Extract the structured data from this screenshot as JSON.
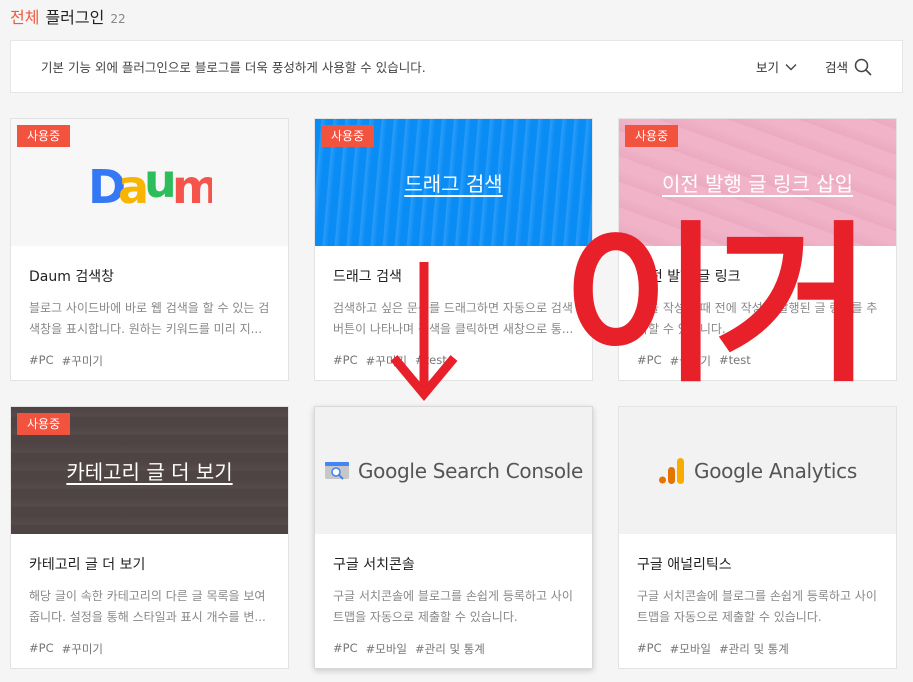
{
  "header": {
    "title_accent": "전체",
    "title_main": "플러그인",
    "count": "22"
  },
  "info_bar": {
    "description": "기본 기능 외에 플러그인으로 블로그를 더욱 풍성하게 사용할 수 있습니다.",
    "view_label": "보기",
    "search_label": "검색"
  },
  "cards": [
    {
      "badge": "사용중",
      "thumb_title": "",
      "name": "Daum 검색창",
      "desc": "블로그 사이드바에 바로 웹 검색을 할 수 있는 검색창을 표시합니다. 원하는 키워드를 미리 지...",
      "tags": [
        "#PC",
        "#꾸미기"
      ]
    },
    {
      "badge": "사용중",
      "thumb_title": "드래그 검색",
      "name": "드래그 검색",
      "desc": "검색하고 싶은 문구를 드래그하면 자동으로 검색 버튼이 나타나며 검색을 클릭하면 새창으로 통...",
      "tags": [
        "#PC",
        "#꾸미기",
        "#test"
      ]
    },
    {
      "badge": "사용중",
      "thumb_title": "이전 발행 글 링크 삽입",
      "name": "이전 발행 글 링크",
      "desc": "글을 작성할 때 전에 작성한 발행된 글 링크를 추가할 수 있습니다.",
      "tags": [
        "#PC",
        "#글쓰기",
        "#test"
      ]
    },
    {
      "badge": "사용중",
      "thumb_title": "카테고리 글 더 보기",
      "name": "카테고리 글 더 보기",
      "desc": "해당 글이 속한 카테고리의 다른 글 목록을 보여줍니다. 설정을 통해 스타일과 표시 개수를 변...",
      "tags": [
        "#PC",
        "#꾸미기"
      ]
    },
    {
      "badge": "",
      "thumb_title": "",
      "logo_text": "Google Search Console",
      "name": "구글 서치콘솔",
      "desc": "구글 서치콘솔에 블로그를 손쉽게 등록하고 사이트맵을 자동으로 제출할 수 있습니다.",
      "tags": [
        "#PC",
        "#모바일",
        "#관리 및 통계"
      ]
    },
    {
      "badge": "",
      "thumb_title": "",
      "logo_text": "Google Analytics",
      "name": "구글 애널리틱스",
      "desc": "구글 서치콘솔에 블로그를 손쉽게 등록하고 사이트맵을 자동으로 제출할 수 있습니다.",
      "tags": [
        "#PC",
        "#모바일",
        "#관리 및 통계"
      ]
    }
  ],
  "annotation": {
    "text": "↓ 이거",
    "color": "#e8202a"
  },
  "colors": {
    "accent": "#f15a3c",
    "badge": "#f2533f"
  }
}
